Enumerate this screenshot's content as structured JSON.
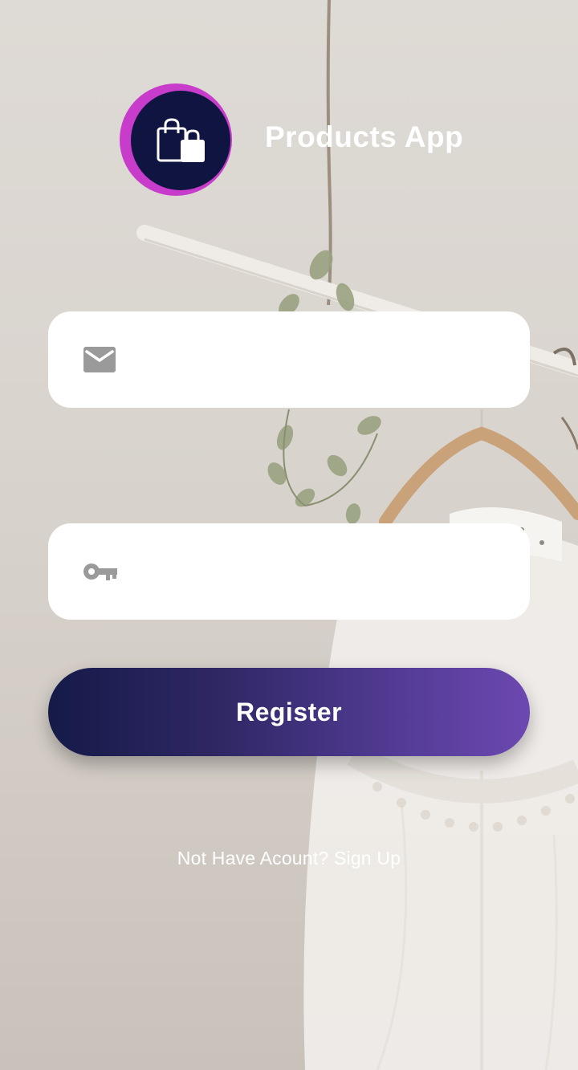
{
  "app": {
    "title": "Products App"
  },
  "form": {
    "email": {
      "value": "",
      "placeholder": "",
      "icon": "mail-icon"
    },
    "password": {
      "value": "",
      "placeholder": "",
      "icon": "key-icon"
    },
    "submit_label": "Register",
    "signup_link": "Not Have Acount? Sign Up"
  },
  "colors": {
    "logo_ring": "#c83ccc",
    "logo_disc": "#0f1540",
    "button_gradient_start": "#151a48",
    "button_gradient_end": "#6c48b0",
    "icon_gray": "#9a9a9a"
  }
}
